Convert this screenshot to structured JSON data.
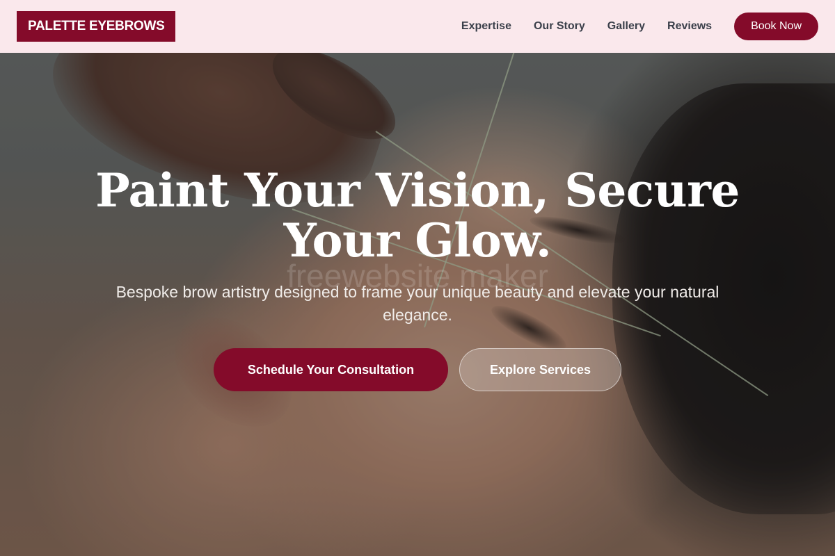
{
  "header": {
    "logo": "PALETTE EYEBROWS",
    "nav": [
      {
        "label": "Expertise"
      },
      {
        "label": "Our Story"
      },
      {
        "label": "Gallery"
      },
      {
        "label": "Reviews"
      }
    ],
    "cta": "Book Now"
  },
  "hero": {
    "headline_line1": "Paint Your Vision, Secure",
    "headline_line2": "Your Glow.",
    "subtitle": "Bespoke brow artistry designed to frame your unique beauty and elevate your natural elegance.",
    "primary_button": "Schedule Your Consultation",
    "secondary_button": "Explore Services",
    "watermark": "freewebsite maker"
  },
  "colors": {
    "accent": "#840b2a",
    "header_bg": "#fae8ec",
    "nav_text": "#3a3f4a"
  }
}
